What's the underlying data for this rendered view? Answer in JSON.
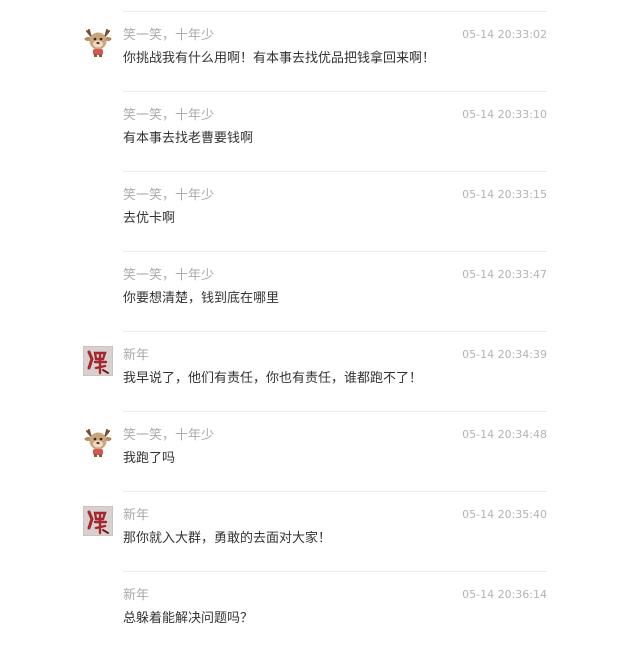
{
  "colors": {
    "divider": "#ebebeb",
    "sender": "#aaaaaa",
    "time": "#b3b3b3",
    "text": "#333333",
    "deer_face": "#c9a57c",
    "deer_antler": "#7a4a2a",
    "calligraphy_bg": "#d7d2cf",
    "calligraphy_ink": "#a3272d"
  },
  "messages": [
    {
      "sender": "笑一笑，十年少",
      "time": "05-14 20:33:02",
      "text": "你挑战我有什么用啊！有本事去找优品把钱拿回来啊！",
      "avatar": "deer-icon"
    },
    {
      "sender": "笑一笑，十年少",
      "time": "05-14 20:33:10",
      "text": "有本事去找老曹要钱啊",
      "avatar": ""
    },
    {
      "sender": "笑一笑，十年少",
      "time": "05-14 20:33:15",
      "text": "去优卡啊",
      "avatar": ""
    },
    {
      "sender": "笑一笑，十年少",
      "time": "05-14 20:33:47",
      "text": "你要想清楚，钱到底在哪里",
      "avatar": ""
    },
    {
      "sender": "新年",
      "time": "05-14 20:34:39",
      "text": "我早说了，他们有责任，你也有责任，谁都跑不了！",
      "avatar": "calligraphy-icon"
    },
    {
      "sender": "笑一笑，十年少",
      "time": "05-14 20:34:48",
      "text": "我跑了吗",
      "avatar": "deer-icon"
    },
    {
      "sender": "新年",
      "time": "05-14 20:35:40",
      "text": "那你就入大群，勇敢的去面对大家！",
      "avatar": "calligraphy-icon"
    },
    {
      "sender": "新年",
      "time": "05-14 20:36:14",
      "text": "总躲着能解决问题吗？",
      "avatar": ""
    }
  ]
}
